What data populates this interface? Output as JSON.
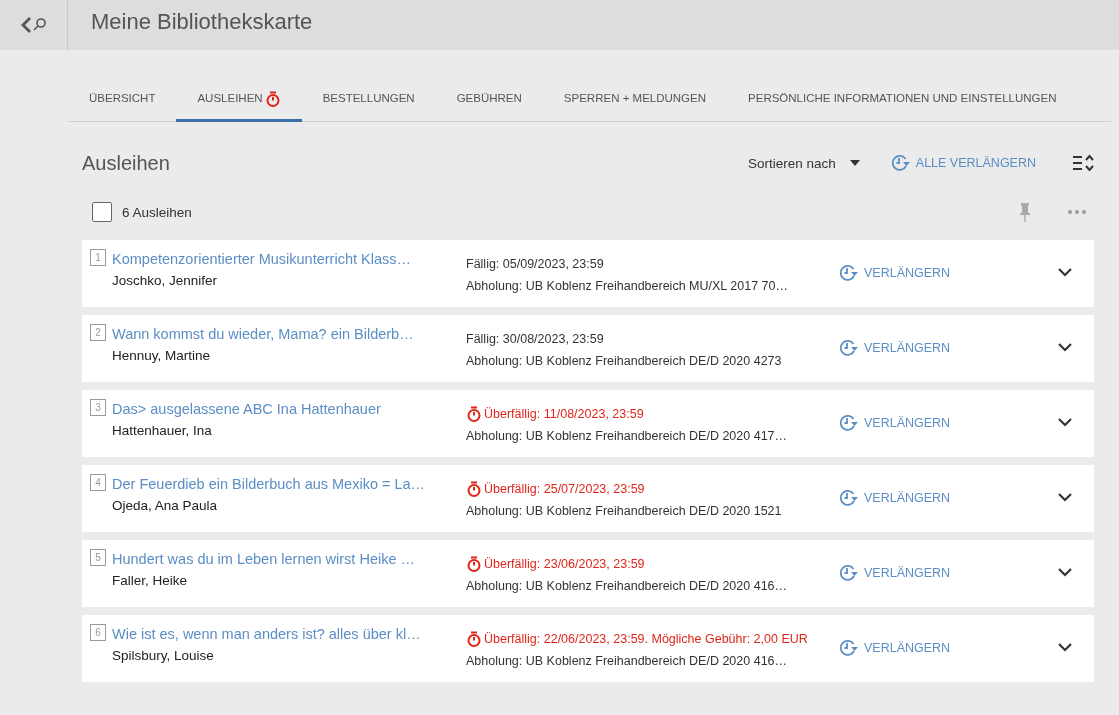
{
  "header": {
    "title": "Meine Bibliothekskarte"
  },
  "tabs": [
    {
      "label": "ÜBERSICHT",
      "selected": false,
      "alert": false
    },
    {
      "label": "AUSLEIHEN",
      "selected": true,
      "alert": true
    },
    {
      "label": "BESTELLUNGEN",
      "selected": false,
      "alert": false
    },
    {
      "label": "GEBÜHREN",
      "selected": false,
      "alert": false
    },
    {
      "label": "SPERREN + MELDUNGEN",
      "selected": false,
      "alert": false
    },
    {
      "label": "PERSÖNLICHE INFORMATIONEN UND EINSTELLUNGEN",
      "selected": false,
      "alert": false
    }
  ],
  "section": {
    "title": "Ausleihen",
    "sort_label": "Sortieren nach",
    "renew_all": "ALLE VERLÄNGERN",
    "select_all": {
      "checked": false,
      "label": "6 Ausleihen"
    }
  },
  "loans": [
    {
      "number": "1",
      "title": "Kompetenzorientierter Musikunterricht Klass…",
      "author": "Joschko, Jennifer",
      "overdue": false,
      "due": "Fällig: 05/09/2023, 23:59",
      "pickup": "Abholung: UB Koblenz Freihandbereich MU/XL 2017 70…",
      "renew": "VERLÄNGERN"
    },
    {
      "number": "2",
      "title": "Wann kommst du wieder, Mama? ein Bilderb…",
      "author": "Hennuy, Martine",
      "overdue": false,
      "due": "Fällig: 30/08/2023, 23:59",
      "pickup": "Abholung: UB Koblenz Freihandbereich DE/D 2020 4273",
      "renew": "VERLÄNGERN"
    },
    {
      "number": "3",
      "title": "Das> ausgelassene ABC Ina Hattenhauer",
      "author": "Hattenhauer, Ina",
      "overdue": true,
      "due": "Überfällig: 11/08/2023, 23:59",
      "pickup": "Abholung: UB Koblenz Freihandbereich DE/D 2020 417…",
      "renew": "VERLÄNGERN"
    },
    {
      "number": "4",
      "title": "Der Feuerdieb ein Bilderbuch aus Mexiko = La…",
      "author": "Ojeda, Ana Paula",
      "overdue": true,
      "due": "Überfällig: 25/07/2023, 23:59",
      "pickup": "Abholung: UB Koblenz Freihandbereich DE/D 2020 1521",
      "renew": "VERLÄNGERN"
    },
    {
      "number": "5",
      "title": "Hundert was du im Leben lernen wirst Heike …",
      "author": "Faller, Heike",
      "overdue": true,
      "due": "Überfällig: 23/06/2023, 23:59",
      "pickup": "Abholung: UB Koblenz Freihandbereich DE/D 2020 416…",
      "renew": "VERLÄNGERN"
    },
    {
      "number": "6",
      "title": "Wie ist es, wenn man anders ist? alles über kl…",
      "author": "Spilsbury, Louise",
      "overdue": true,
      "due": "Überfällig: 22/06/2023, 23:59. Mögliche Gebühr: 2,00 EUR",
      "pickup": "Abholung: UB Koblenz Freihandbereich DE/D 2020 416…",
      "renew": "VERLÄNGERN"
    }
  ]
}
